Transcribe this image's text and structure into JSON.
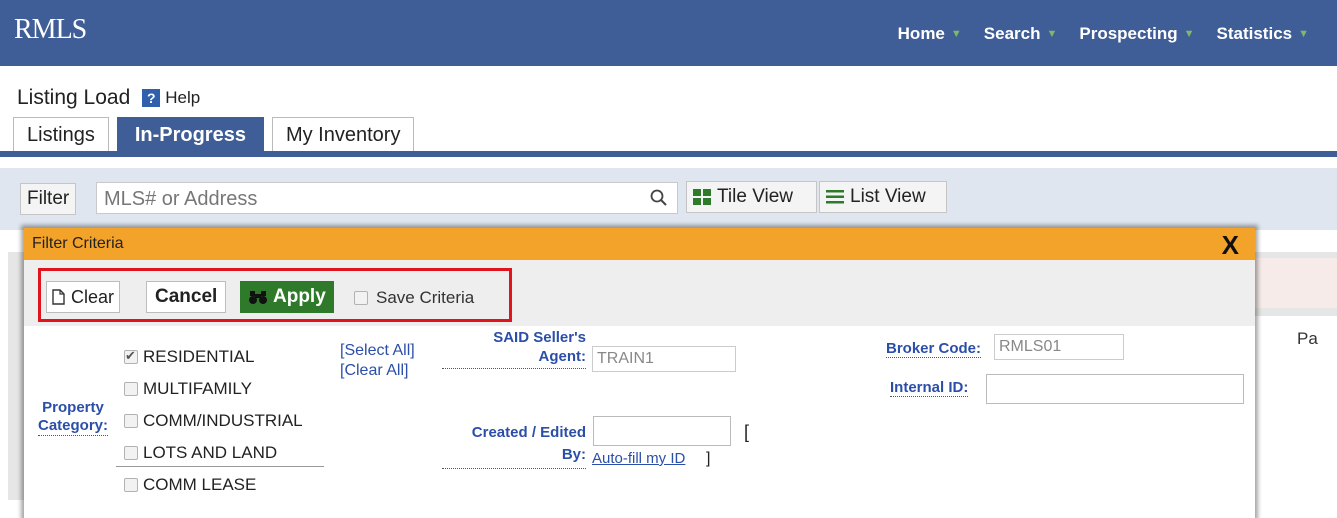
{
  "app": {
    "logo": "RMLS"
  },
  "nav": {
    "items": [
      "Home",
      "Search",
      "Prospecting",
      "Statistics"
    ]
  },
  "page": {
    "title": "Listing Load",
    "help": "Help"
  },
  "tabs": [
    "Listings",
    "In-Progress",
    "My Inventory"
  ],
  "active_tab": "In-Progress",
  "filter": {
    "label": "Filter",
    "placeholder": "MLS# or Address",
    "tile_view": "Tile View",
    "list_view": "List View"
  },
  "background": {
    "page_peek": "Pa"
  },
  "dialog": {
    "title": "Filter Criteria",
    "close": "X",
    "toolbar": {
      "clear": "Clear",
      "cancel": "Cancel",
      "apply": "Apply",
      "save_criteria": "Save Criteria"
    },
    "property": {
      "label_line1": "Property",
      "label_line2": "Category:",
      "select_all": "[Select All]",
      "clear_all": "[Clear All]",
      "options": [
        {
          "label": "RESIDENTIAL",
          "checked": true
        },
        {
          "label": "MULTIFAMILY",
          "checked": false
        },
        {
          "label": "COMM/INDUSTRIAL",
          "checked": false
        },
        {
          "label": "LOTS AND LAND",
          "checked": false
        },
        {
          "label": "COMM LEASE",
          "checked": false
        }
      ]
    },
    "said": {
      "label_line1": "SAID Seller's",
      "label_line2": "Agent:",
      "value": "TRAIN1"
    },
    "created": {
      "label_line1": "Created / Edited",
      "label_line2": "By:",
      "bracket_open": "[",
      "autofill": "Auto-fill my ID",
      "bracket_close": "]"
    },
    "broker": {
      "label": "Broker Code:",
      "value": "RMLS01"
    },
    "internal": {
      "label": "Internal ID:",
      "value": ""
    }
  },
  "colors": {
    "nav_bg": "#3f5d97",
    "dialog_header": "#f4a32a",
    "apply_button": "#2f7a2a",
    "highlight_border": "#e0141c",
    "link": "#2b4fa8"
  }
}
